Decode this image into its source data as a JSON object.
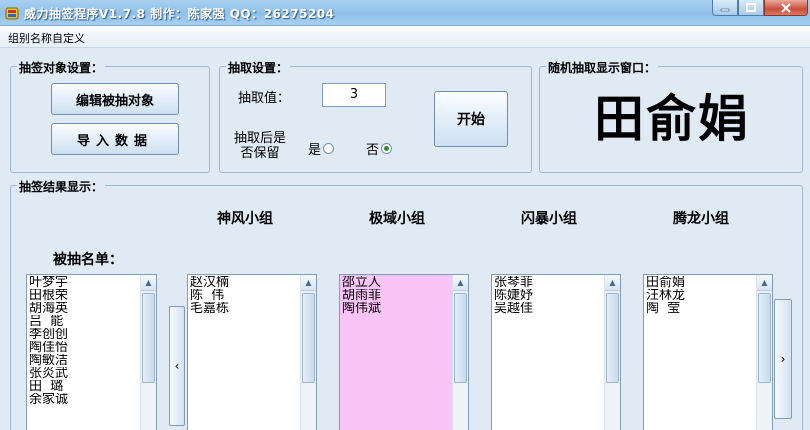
{
  "window": {
    "title": "威力抽签程序V1.7.8  制作：陈家强  QQ：26275204",
    "controls": {
      "minimize": "—",
      "maximize": "▭",
      "close": "✕"
    }
  },
  "menu": {
    "items": [
      "组别名称自定义"
    ]
  },
  "object_setup": {
    "legend": "抽签对象设置：",
    "edit_button": "编辑被抽对象",
    "import_button": "导入数据"
  },
  "draw_setup": {
    "legend": "抽取设置：",
    "count_label": "抽取值：",
    "count_value": "3",
    "keep_label": "抽取后是否保留",
    "yes_label": "是",
    "no_label": "否",
    "selected": "否",
    "start_button": "开始"
  },
  "display": {
    "legend": "随机抽取显示窗口：",
    "name": "田俞娟"
  },
  "results": {
    "legend": "抽签结果显示：",
    "pool_label": "被抽名单：",
    "pool": [
      "叶梦宇",
      "田根荣",
      "胡海英",
      "吕  能",
      "李创创",
      "陶佳怡",
      "陶敏洁",
      "张炎武",
      "田  璐",
      "余家诚"
    ],
    "groups": [
      {
        "name": "神风小组",
        "members": [
          "赵汉楠",
          "陈  伟",
          "毛嘉栋"
        ]
      },
      {
        "name": "极域小组",
        "members": [
          "邵立人",
          "胡雨菲",
          "陶伟斌"
        ]
      },
      {
        "name": "闪暴小组",
        "members": [
          "张琴菲",
          "陈婕妤",
          "吴越佳"
        ]
      },
      {
        "name": "腾龙小组",
        "members": [
          "田俞娟",
          "汪林龙",
          "陶  莹"
        ]
      }
    ],
    "prev_arrow": "‹",
    "next_arrow": "›"
  },
  "colors": {
    "window_bg": "#dfeaf5",
    "title_bar": "#8fc0ea",
    "highlight_list": "#fbc4f6"
  }
}
